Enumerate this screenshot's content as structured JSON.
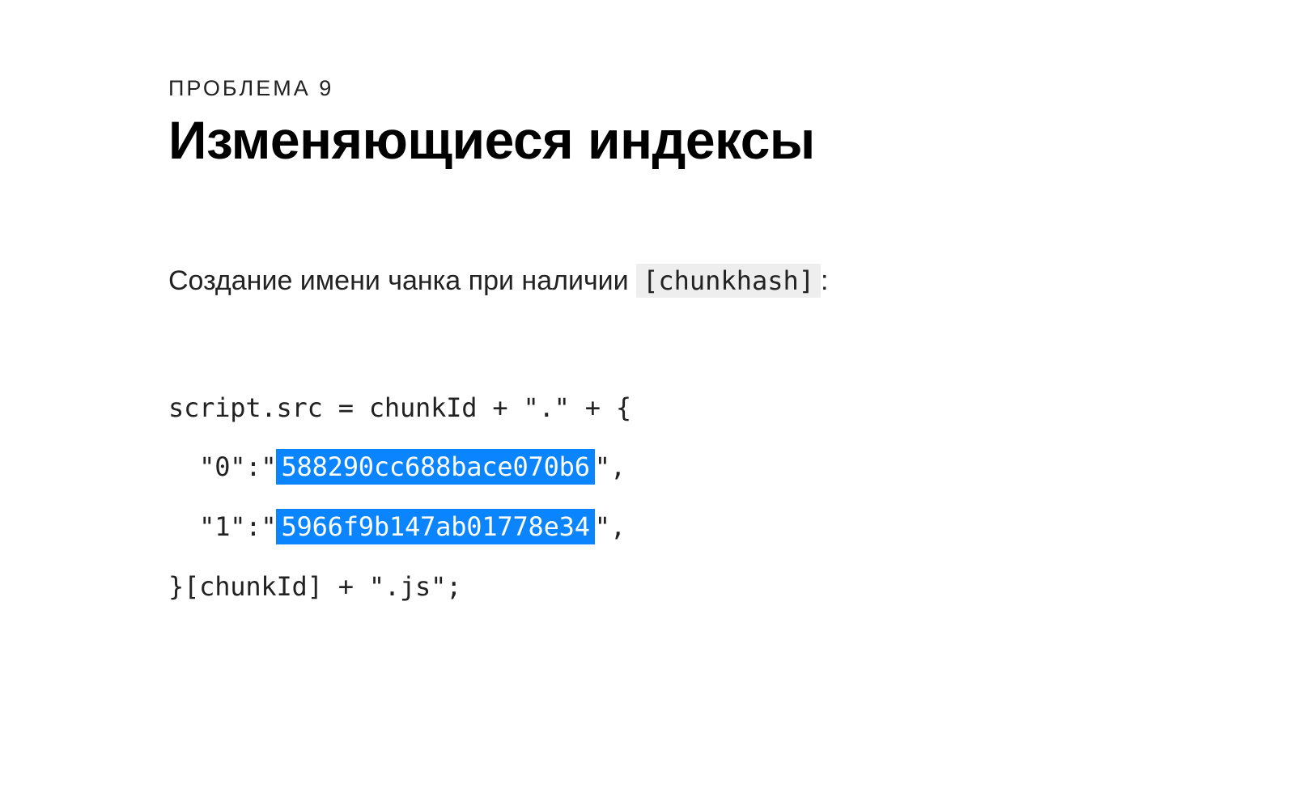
{
  "eyebrow": "ПРОБЛЕМА 9",
  "title": "Изменяющиеся индексы",
  "lead_prefix": "Создание имени чанка при наличии ",
  "lead_chip": "[chunkhash]",
  "lead_suffix": ":",
  "code": {
    "line1": "script.src = chunkId + \".\" + {",
    "l2_pre": "  \"0\":\"",
    "l2_hash": "588290cc688bace070b6",
    "l2_post": "\",",
    "l3_pre": "  \"1\":\"",
    "l3_hash": "5966f9b147ab01778e34",
    "l3_post": "\",",
    "line4": "}[chunkId] + \".js\";"
  }
}
